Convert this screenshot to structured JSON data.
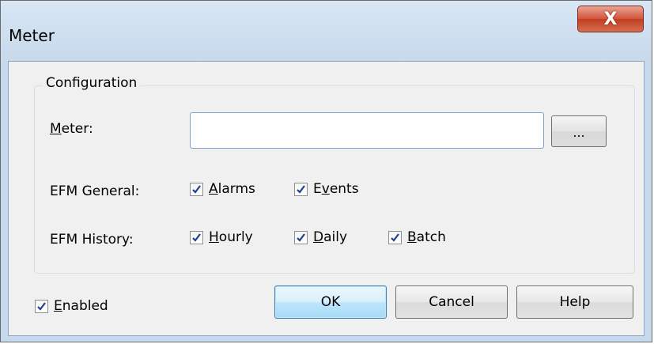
{
  "window": {
    "title": "Meter",
    "close_label": "X"
  },
  "configuration": {
    "legend": "Configuration",
    "meter_label_first": "M",
    "meter_label_rest": "eter:",
    "meter_value": "",
    "browse_label": "...",
    "efm_general_label": "EFM General:",
    "efm_history_label": "EFM History:",
    "alarms": {
      "first": "A",
      "rest": "larms",
      "checked": true
    },
    "events": {
      "first": "E",
      "underlined": "v",
      "rest": "ents",
      "checked": true
    },
    "hourly": {
      "first": "H",
      "rest": "ourly",
      "checked": true
    },
    "daily": {
      "first": "D",
      "rest": "aily",
      "checked": true
    },
    "batch": {
      "first": "B",
      "rest": "atch",
      "checked": true
    }
  },
  "footer": {
    "enabled": {
      "first": "E",
      "rest": "nabled",
      "checked": true
    },
    "ok_label": "OK",
    "cancel_label": "Cancel",
    "help_label": "Help"
  },
  "colors": {
    "titlebar": "#c7d9ec",
    "client": "#f0f0f0",
    "close_button": "#c23c22",
    "default_button": "#bee6fd",
    "checkmark": "#1e3f8a"
  },
  "icons": {
    "close": "close-x-icon",
    "check": "checkmark-icon"
  }
}
